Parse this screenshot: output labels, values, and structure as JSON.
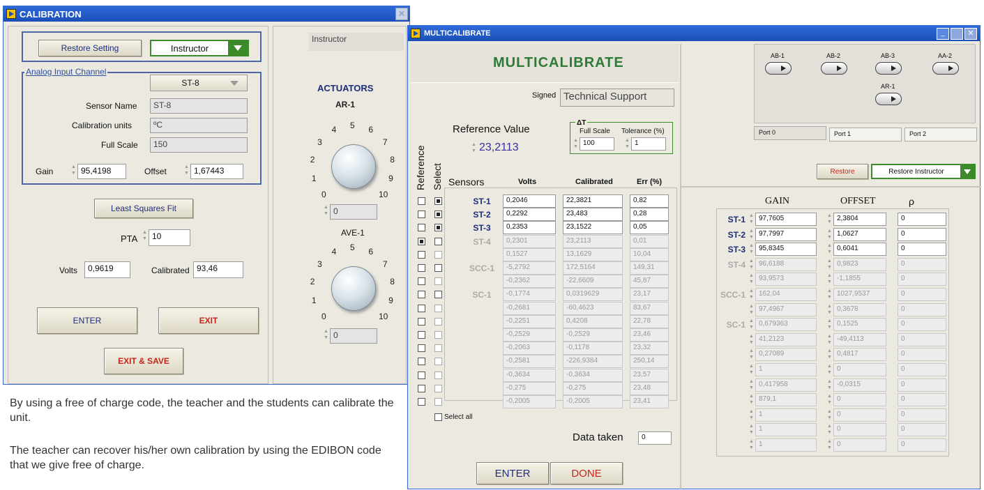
{
  "calibration": {
    "title": "CALIBRATION",
    "restore_label": "Restore Setting",
    "user_select": "Instructor",
    "user_display": "Instructor",
    "group_label": "Analog Input Channel",
    "channel": "ST-8",
    "sensor_name_label": "Sensor Name",
    "sensor_name": "ST-8",
    "units_label": "Calibration units",
    "units": "ºC",
    "full_scale_label": "Full Scale",
    "full_scale": "150",
    "gain_label": "Gain",
    "gain": "95,4198",
    "offset_label": "Offset",
    "offset": "1,67443",
    "lsq_label": "Least Squares Fit",
    "pta_label": "PTA",
    "pta": "10",
    "volts_label": "Volts",
    "volts": "0,9619",
    "calibrated_label": "Calibrated",
    "calibrated": "93,46",
    "enter_label": "ENTER",
    "exit_label": "EXIT",
    "exit_save_label": "EXIT & SAVE",
    "actuators_label": "ACTUATORS",
    "ar1_label": "AR-1",
    "ar1_value": "0",
    "ave1_label": "AVE-1",
    "ave1_value": "0",
    "dial_ticks": [
      "0",
      "1",
      "2",
      "3",
      "4",
      "5",
      "6",
      "7",
      "8",
      "9",
      "10"
    ]
  },
  "caption": {
    "p1": "By using a free of charge code, the teacher and the students can calibrate the unit.",
    "p2": "The teacher can recover his/her own calibration by using the EDIBON code that we give free of charge."
  },
  "multi": {
    "title": "MULTICALIBRATE",
    "heading": "MULTICALIBRATE",
    "signed_label": "Signed",
    "signed": "Technical Support",
    "ref_label": "Reference Value",
    "ref_value": "23,2113",
    "at_label": "ΔT",
    "fullscale_label": "Full Scale",
    "fullscale": "100",
    "tol_label": "Tolerance (%)",
    "tol": "1",
    "reference_vlabel": "Reference",
    "select_vlabel": "Select",
    "col_sensors": "Sensors",
    "col_volts": "Volts",
    "col_calibrated": "Calibrated",
    "col_err": "Err (%)",
    "select_all_label": "Select all",
    "data_taken_label": "Data taken",
    "data_taken": "0",
    "enter_label": "ENTER",
    "done_label": "DONE",
    "ports": [
      {
        "label": "Port 0"
      },
      {
        "label": "Port 1"
      },
      {
        "label": "Port 2"
      }
    ],
    "toggles": [
      "AB-1",
      "AB-2",
      "AB-3",
      "AA-2",
      "AR-1"
    ],
    "restore_label": "Restore",
    "restore_instructor": "Restore Instructor",
    "col_gain": "GAIN",
    "col_offset": "OFFSET",
    "col_rho": "ρ",
    "rows": [
      {
        "name": "ST-1",
        "volts": "0,2046",
        "cal": "22,3821",
        "err": "0,82",
        "gain": "97,7605",
        "offset": "2,3804",
        "rho": "0",
        "ref": false,
        "sel": true,
        "active": true
      },
      {
        "name": "ST-2",
        "volts": "0,2292",
        "cal": "23,483",
        "err": "0,28",
        "gain": "97,7997",
        "offset": "1,0627",
        "rho": "0",
        "ref": false,
        "sel": true,
        "active": true
      },
      {
        "name": "ST-3",
        "volts": "0,2353",
        "cal": "23,1522",
        "err": "0,05",
        "gain": "95,8345",
        "offset": "0,6041",
        "rho": "0",
        "ref": false,
        "sel": true,
        "active": true
      },
      {
        "name": "ST-4",
        "volts": "0,2301",
        "cal": "23,2113",
        "err": "0,01",
        "gain": "96,6188",
        "offset": "0,9823",
        "rho": "0",
        "ref": true,
        "sel": false,
        "active": false
      },
      {
        "name": "",
        "volts": "0,1527",
        "cal": "13,1629",
        "err": "10,04",
        "gain": "93,9573",
        "offset": "-1,1855",
        "rho": "0",
        "ref": false,
        "sel": false,
        "active": false
      },
      {
        "name": "SCC-1",
        "volts": "-5,2792",
        "cal": "172,5164",
        "err": "149,31",
        "gain": "162,04",
        "offset": "1027,9537",
        "rho": "0",
        "ref": false,
        "sel": false,
        "active": false
      },
      {
        "name": "",
        "volts": "-0,2362",
        "cal": "-22,6609",
        "err": "45,87",
        "gain": "97,4967",
        "offset": "0,3678",
        "rho": "0",
        "ref": false,
        "sel": false,
        "active": false
      },
      {
        "name": "SC-1",
        "volts": "-0,1774",
        "cal": "0,0319629",
        "err": "23,17",
        "gain": "0,679363",
        "offset": "0,1525",
        "rho": "0",
        "ref": false,
        "sel": false,
        "active": false
      },
      {
        "name": "",
        "volts": "-0,2681",
        "cal": "-60,4623",
        "err": "83,67",
        "gain": "41,2123",
        "offset": "-49,4113",
        "rho": "0",
        "ref": false,
        "sel": false,
        "active": false
      },
      {
        "name": "",
        "volts": "-0,2251",
        "cal": "0,4208",
        "err": "22,78",
        "gain": "0,27089",
        "offset": "0,4817",
        "rho": "0",
        "ref": false,
        "sel": false,
        "active": false
      },
      {
        "name": "",
        "volts": "-0,2529",
        "cal": "-0,2529",
        "err": "23,46",
        "gain": "1",
        "offset": "0",
        "rho": "0",
        "ref": false,
        "sel": false,
        "active": false
      },
      {
        "name": "",
        "volts": "-0,2063",
        "cal": "-0,1178",
        "err": "23,32",
        "gain": "0,417958",
        "offset": "-0,0315",
        "rho": "0",
        "ref": false,
        "sel": false,
        "active": false
      },
      {
        "name": "",
        "volts": "-0,2581",
        "cal": "-226,9384",
        "err": "250,14",
        "gain": "879,1",
        "offset": "0",
        "rho": "0",
        "ref": false,
        "sel": false,
        "active": false
      },
      {
        "name": "",
        "volts": "-0,3634",
        "cal": "-0,3634",
        "err": "23,57",
        "gain": "1",
        "offset": "0",
        "rho": "0",
        "ref": false,
        "sel": false,
        "active": false
      },
      {
        "name": "",
        "volts": "-0,275",
        "cal": "-0,275",
        "err": "23,48",
        "gain": "1",
        "offset": "0",
        "rho": "0",
        "ref": false,
        "sel": false,
        "active": false
      },
      {
        "name": "",
        "volts": "-0,2005",
        "cal": "-0,2005",
        "err": "23,41",
        "gain": "1",
        "offset": "0",
        "rho": "0",
        "ref": false,
        "sel": false,
        "active": false
      }
    ]
  }
}
